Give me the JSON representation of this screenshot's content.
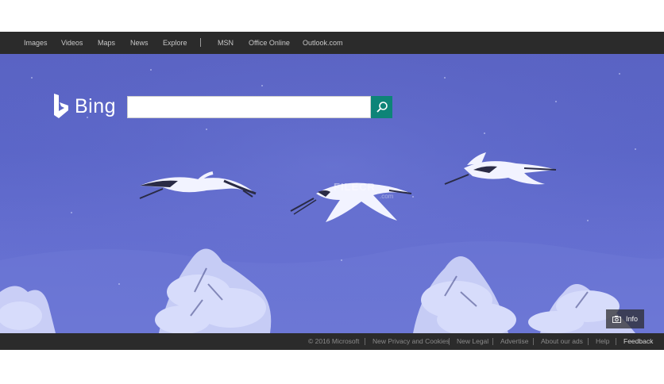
{
  "topnav": {
    "items": [
      "Images",
      "Videos",
      "Maps",
      "News",
      "Explore",
      "MSN",
      "Office Online",
      "Outlook.com"
    ]
  },
  "brand": {
    "name": "Bing",
    "accent": "#0d8478"
  },
  "search": {
    "value": ""
  },
  "info_button": {
    "label": "Info",
    "icon": "camera-icon"
  },
  "watermark": {
    "main": "FILECR",
    "sub": ".com"
  },
  "footer": {
    "copyright": "© 2016 Microsoft",
    "links": [
      "New Privacy and Cookies",
      "New Legal",
      "Advertise",
      "About our ads",
      "Help",
      "Feedback"
    ]
  },
  "colors": {
    "bar": "#2b2b2b",
    "sky": "#5b66c8"
  }
}
